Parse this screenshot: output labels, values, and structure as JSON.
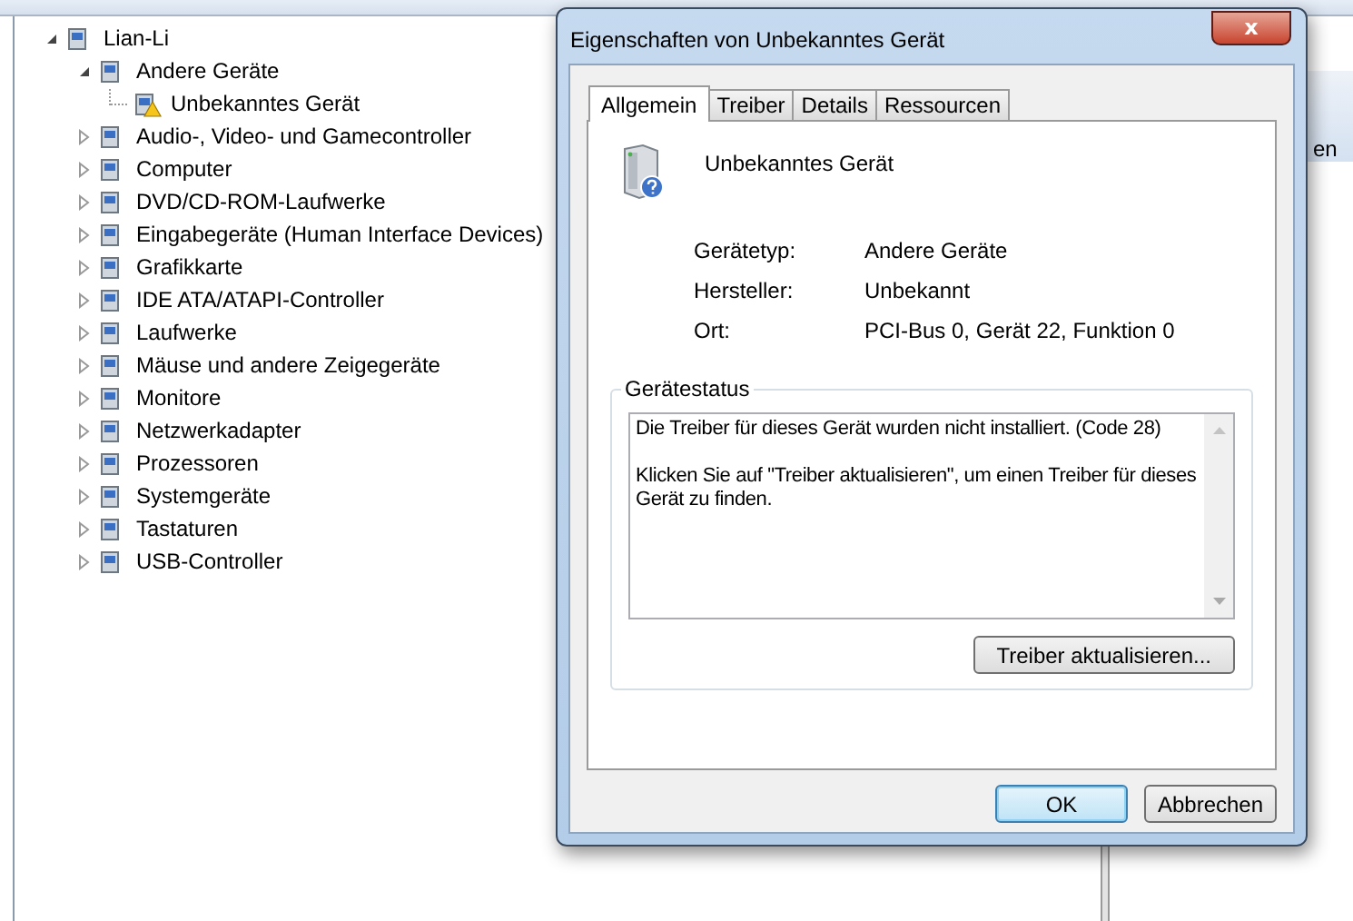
{
  "tree": [
    {
      "label": "Lian-Li",
      "expanded": true,
      "children": [
        {
          "label": "Andere Geräte",
          "expanded": true,
          "children": [
            {
              "label": "Unbekanntes Gerät",
              "warning": true
            }
          ]
        },
        {
          "label": "Audio-, Video- und Gamecontroller",
          "expanded": false
        },
        {
          "label": "Computer",
          "expanded": false
        },
        {
          "label": "DVD/CD-ROM-Laufwerke",
          "expanded": false
        },
        {
          "label": "Eingabegeräte (Human Interface Devices)",
          "expanded": false
        },
        {
          "label": "Grafikkarte",
          "expanded": false
        },
        {
          "label": "IDE ATA/ATAPI-Controller",
          "expanded": false
        },
        {
          "label": "Laufwerke",
          "expanded": false
        },
        {
          "label": "Mäuse und andere Zeigegeräte",
          "expanded": false
        },
        {
          "label": "Monitore",
          "expanded": false
        },
        {
          "label": "Netzwerkadapter",
          "expanded": false
        },
        {
          "label": "Prozessoren",
          "expanded": false
        },
        {
          "label": "Systemgeräte",
          "expanded": false
        },
        {
          "label": "Tastaturen",
          "expanded": false
        },
        {
          "label": "USB-Controller",
          "expanded": false
        }
      ]
    }
  ],
  "right_pane": {
    "text_fragment": "en"
  },
  "dialog": {
    "title": "Eigenschaften von Unbekanntes Gerät",
    "close": "x",
    "tabs": [
      {
        "label": "Allgemein",
        "selected": true
      },
      {
        "label": "Treiber",
        "selected": false
      },
      {
        "label": "Details",
        "selected": false
      },
      {
        "label": "Ressourcen",
        "selected": false
      }
    ],
    "device_name": "Unbekanntes Gerät",
    "properties": [
      {
        "label": "Gerätetyp:",
        "value": "Andere Geräte"
      },
      {
        "label": "Hersteller:",
        "value": "Unbekannt"
      },
      {
        "label": "Ort:",
        "value": "PCI-Bus 0, Gerät 22, Funktion 0"
      }
    ],
    "status": {
      "title": "Gerätestatus",
      "lines": [
        "Die Treiber für dieses Gerät wurden nicht installiert. (Code 28)",
        "Klicken Sie auf \"Treiber aktualisieren\", um einen Treiber für dieses Gerät zu finden."
      ],
      "button": "Treiber aktualisieren..."
    },
    "buttons": [
      {
        "label": "OK",
        "default": true
      },
      {
        "label": "Abbrechen",
        "default": false
      }
    ]
  }
}
